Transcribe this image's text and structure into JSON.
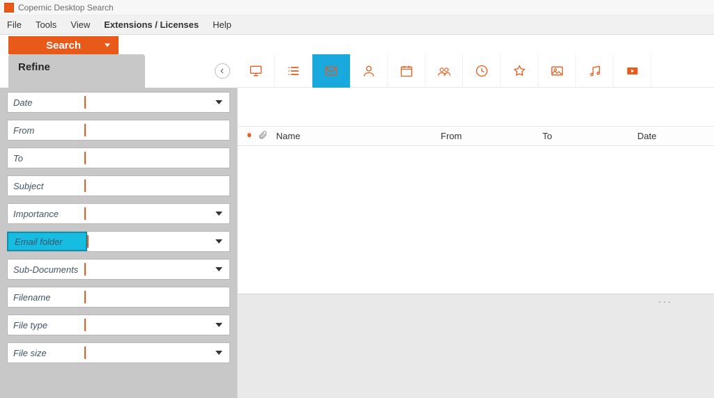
{
  "app": {
    "title": "Copernic Desktop Search"
  },
  "menu": {
    "file": "File",
    "tools": "Tools",
    "view": "View",
    "extensions": "Extensions / Licenses",
    "help": "Help"
  },
  "search": {
    "button_label": "Search"
  },
  "refine": {
    "title": "Refine",
    "fields": [
      {
        "label": "Date",
        "has_dropdown": true
      },
      {
        "label": "From",
        "has_dropdown": false
      },
      {
        "label": "To",
        "has_dropdown": false
      },
      {
        "label": "Subject",
        "has_dropdown": false
      },
      {
        "label": "Importance",
        "has_dropdown": true
      },
      {
        "label": "Email folder",
        "has_dropdown": true,
        "highlighted": true
      },
      {
        "label": "Sub-Documents",
        "has_dropdown": true
      },
      {
        "label": "Filename",
        "has_dropdown": false
      },
      {
        "label": "File type",
        "has_dropdown": true
      },
      {
        "label": "File size",
        "has_dropdown": true
      }
    ]
  },
  "categories": {
    "back_icon": "back-icon",
    "items": [
      {
        "name": "desktop-icon"
      },
      {
        "name": "list-icon"
      },
      {
        "name": "email-icon",
        "active": true
      },
      {
        "name": "contact-icon"
      },
      {
        "name": "calendar-icon"
      },
      {
        "name": "teams-icon"
      },
      {
        "name": "history-icon"
      },
      {
        "name": "favorite-icon"
      },
      {
        "name": "picture-icon"
      },
      {
        "name": "music-icon"
      },
      {
        "name": "video-icon"
      }
    ]
  },
  "results": {
    "columns": {
      "name": "Name",
      "from": "From",
      "to": "To",
      "date": "Date"
    },
    "preview_menu": "···"
  }
}
